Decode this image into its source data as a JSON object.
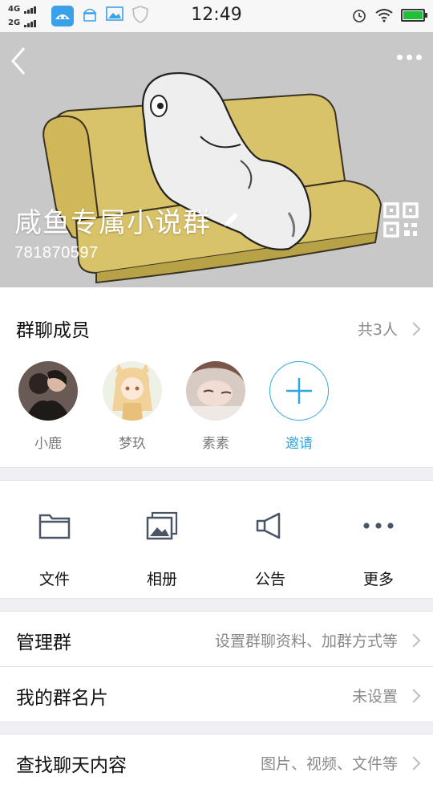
{
  "status_bar": {
    "network_top": "4G",
    "network_bottom": "2G",
    "time": "12:49",
    "battery_color": "#1fbf3a"
  },
  "header": {
    "group_name": "咸鱼专属小说群",
    "group_id": "781870597",
    "back_icon": "chevron-left-icon",
    "more_icon": "more-horizontal-icon",
    "edit_icon": "pencil-icon",
    "qr_icon": "qr-code-icon"
  },
  "members": {
    "title": "群聊成员",
    "count_label": "共3人",
    "items": [
      {
        "name": "小鹿"
      },
      {
        "name": "梦玖"
      },
      {
        "name": "素素"
      }
    ],
    "invite_label": "邀请",
    "accent_color": "#2fa8de"
  },
  "actions": [
    {
      "label": "文件",
      "icon": "folder-icon"
    },
    {
      "label": "相册",
      "icon": "photo-album-icon"
    },
    {
      "label": "公告",
      "icon": "megaphone-icon"
    },
    {
      "label": "更多",
      "icon": "more-horizontal-icon"
    }
  ],
  "rows": {
    "manage": {
      "title": "管理群",
      "value": "设置群聊资料、加群方式等"
    },
    "card": {
      "title": "我的群名片",
      "value": "未设置"
    },
    "search": {
      "title": "查找聊天内容",
      "value": "图片、视频、文件等"
    }
  }
}
